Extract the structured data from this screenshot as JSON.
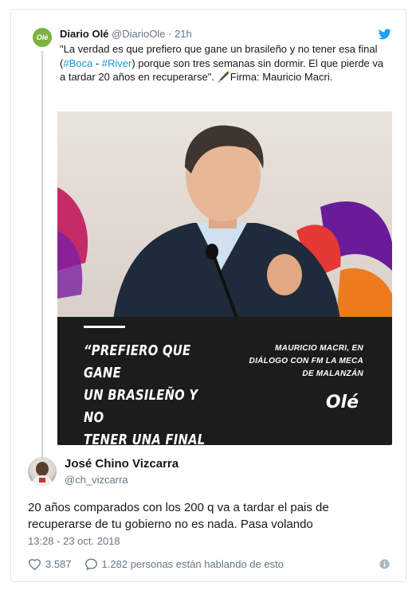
{
  "parent": {
    "name": "Diario Olé",
    "handle": "@DiarioOle",
    "dot": "·",
    "time": "21h",
    "avatar_text": "Olé",
    "text_before": "\"La verdad es que prefiero que gane un brasileño y no tener esa final (",
    "hashtag1": "#Boca",
    "sep": " - ",
    "hashtag2": "#River",
    "text_after": ") porque son tres semanas sin dormir. El que pierde va a tardar 20 años en recuperarse\". 🖋️Firma: Mauricio Macri.",
    "media": {
      "quote": "“PREFIERO QUE GANE\nUN BRASILEÑO Y NO\nTENER UNA FINAL\nBOCA - RIVER”",
      "attribution": "MAURICIO MACRI, EN\nDIÁLOGO CON FM LA MECA\nDE MALANZÁN",
      "logo": "Olé"
    }
  },
  "reply": {
    "name": "José Chino Vizcarra",
    "handle": "@ch_vizcarra",
    "text": "20 años comparados con los 200 q va a tardar el pais de recuperarse de tu gobierno no es nada. Pasa volando",
    "timestamp": "13:28 - 23 oct. 2018",
    "likes": "3.587",
    "replies_text": "1.282 personas están hablando de esto"
  },
  "colors": {
    "link": "#1b95e0",
    "secondary_text": "#657786",
    "brand_green": "#7cb342",
    "twitter_blue": "#1da1f2"
  }
}
